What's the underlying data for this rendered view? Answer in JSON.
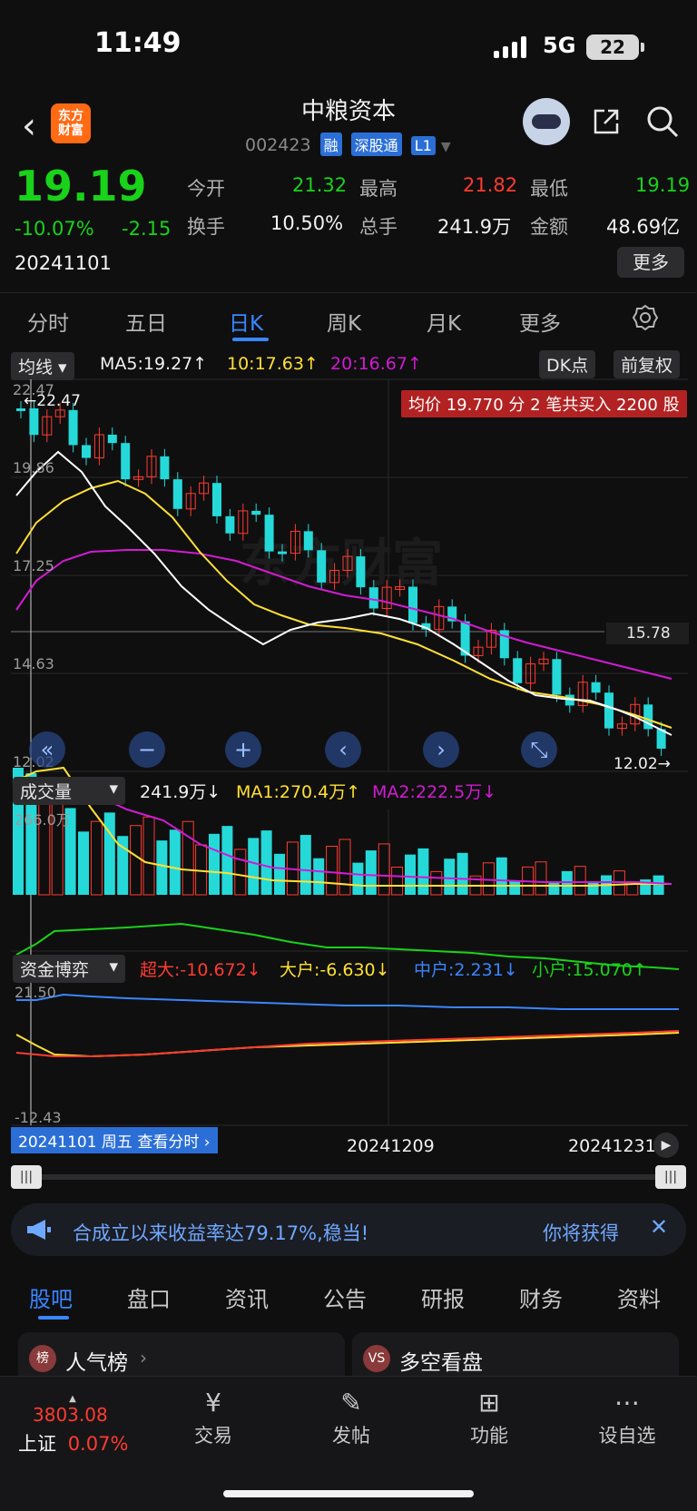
{
  "status": {
    "time": "11:49",
    "network": "5G",
    "battery": "22"
  },
  "header": {
    "logo_text": "东方\n财富",
    "title": "中粮资本",
    "code": "002423",
    "tags": [
      "融",
      "深股通",
      "L1"
    ]
  },
  "quote": {
    "price": "19.19",
    "change_pct": "-10.07%",
    "change": "-2.15",
    "date": "20241101",
    "fields": [
      {
        "label": "今开",
        "value": "21.32",
        "color": "green"
      },
      {
        "label": "最高",
        "value": "21.82",
        "color": "red"
      },
      {
        "label": "最低",
        "value": "19.19",
        "color": "green"
      },
      {
        "label": "换手",
        "value": "10.50%",
        "color": "white"
      },
      {
        "label": "总手",
        "value": "241.9万",
        "color": "white"
      },
      {
        "label": "金额",
        "value": "48.69亿",
        "color": "white"
      }
    ],
    "more": "更多"
  },
  "tabs": [
    "分时",
    "五日",
    "日K",
    "周K",
    "月K",
    "更多"
  ],
  "active_tab": "日K",
  "kline": {
    "selector": "均线",
    "ma5": "MA5:19.27↑",
    "ma10": "10:17.63↑",
    "ma20": "20:16.67↑",
    "dk": "DK点",
    "adjust": "前复权",
    "avg_notice": "均价 19.770 分 2 笔共买入 2200 股",
    "y_labels": [
      "22.47",
      "19.86",
      "17.25",
      "14.63",
      "12.02"
    ],
    "hi_label": "22.47",
    "lo_label": "12.02",
    "ref_price": "15.78"
  },
  "volume": {
    "selector": "成交量",
    "vol": "241.9万↓",
    "ma1": "MA1:270.4万↑",
    "ma2": "MA2:222.5万↓",
    "max_label": "266.0万"
  },
  "capital": {
    "selector": "资金博弈",
    "super": "超大:-10.672↓",
    "large": "大户:-6.630↓",
    "mid": "中户:2.231↓",
    "small": "小户:15.070↑",
    "top_label": "21.50",
    "bottom_label": "-12.43"
  },
  "xaxis": {
    "cursor_label": "20241101 周五 查看分时",
    "dates": [
      "20241209",
      "20241231"
    ]
  },
  "banner": {
    "text": "合成立以来收益率达79.17%,稳当!",
    "right": "你将获得",
    "close": "✕"
  },
  "subtabs": [
    "股吧",
    "盘口",
    "资讯",
    "公告",
    "研报",
    "财务",
    "资料"
  ],
  "active_subtab": "股吧",
  "cards": [
    {
      "title": "人气榜"
    },
    {
      "title": "多空看盘"
    }
  ],
  "bottom_nav": {
    "index_value": "3803.08",
    "index_name": "上证",
    "index_change": "0.07%",
    "items": [
      "交易",
      "发帖",
      "功能",
      "设自选"
    ]
  },
  "colors": {
    "up": "#ff3b30",
    "down": "#25d9d9",
    "ma5": "#ffffff",
    "ma10": "#ffe033",
    "ma20": "#d21bd2",
    "accent": "#3a86ff"
  }
}
